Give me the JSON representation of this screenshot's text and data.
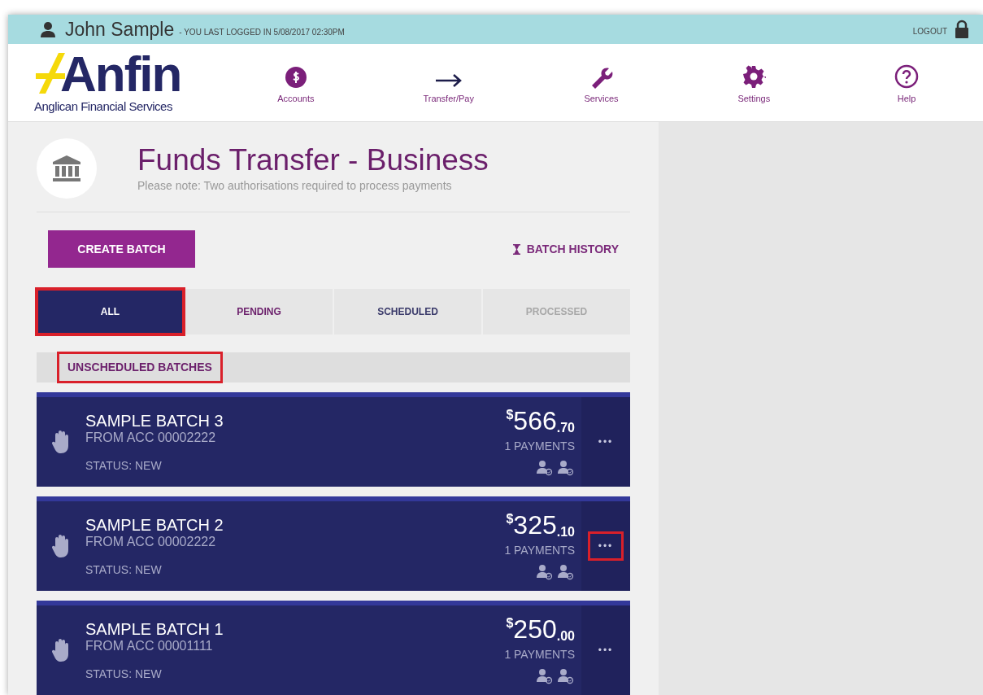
{
  "user_bar": {
    "name": "John Sample",
    "last_login": "- YOU LAST LOGGED IN 5/08/2017 02:30PM",
    "logout": "LOGOUT"
  },
  "logo": {
    "word": "Anfin",
    "tagline": "Anglican Financial Services"
  },
  "nav": [
    {
      "kind": "accounts",
      "label": "Accounts"
    },
    {
      "kind": "transfer",
      "label": "Transfer/Pay"
    },
    {
      "kind": "services",
      "label": "Services"
    },
    {
      "kind": "settings",
      "label": "Settings"
    },
    {
      "kind": "help",
      "label": "Help"
    }
  ],
  "page": {
    "title": "Funds Transfer - Business",
    "note": "Please note: Two authorisations required to process payments"
  },
  "actions": {
    "create": "CREATE BATCH",
    "history": "BATCH HISTORY"
  },
  "tabs": [
    {
      "label": "ALL",
      "selected": true,
      "disabled": false,
      "highlighted": true
    },
    {
      "label": "PENDING",
      "selected": false,
      "disabled": false,
      "highlighted": false
    },
    {
      "label": "SCHEDULED",
      "selected": false,
      "disabled": false,
      "highlighted": false
    },
    {
      "label": "PROCESSED",
      "selected": false,
      "disabled": true,
      "highlighted": false
    }
  ],
  "section": {
    "label": "UNSCHEDULED BATCHES",
    "highlighted": true
  },
  "batches": [
    {
      "name": "SAMPLE BATCH 3",
      "from": "FROM ACC 00002222",
      "status": "STATUS: NEW",
      "currency": "$",
      "whole": "566",
      "cents": ".70",
      "payments": "1 PAYMENTS",
      "more": "•••",
      "more_highlighted": false
    },
    {
      "name": "SAMPLE BATCH 2",
      "from": "FROM ACC 00002222",
      "status": "STATUS: NEW",
      "currency": "$",
      "whole": "325",
      "cents": ".10",
      "payments": "1 PAYMENTS",
      "more": "•••",
      "more_highlighted": true
    },
    {
      "name": "SAMPLE BATCH 1",
      "from": "FROM ACC 00001111",
      "status": "STATUS: NEW",
      "currency": "$",
      "whole": "250",
      "cents": ".00",
      "payments": "1 PAYMENTS",
      "more": "•••",
      "more_highlighted": false
    }
  ]
}
